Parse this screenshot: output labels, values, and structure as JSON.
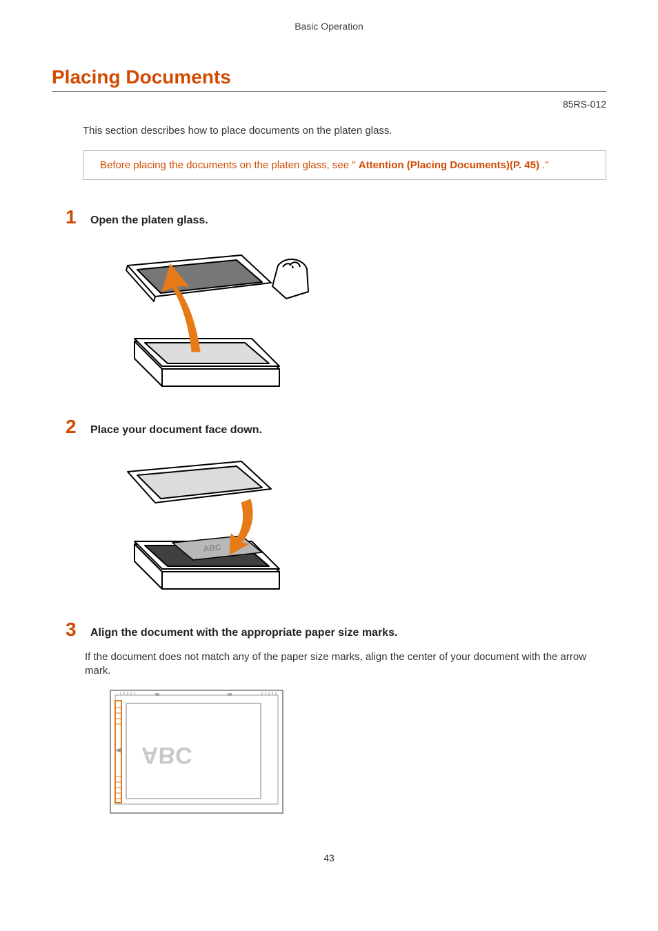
{
  "header": {
    "section_label": "Basic Operation"
  },
  "title": "Placing Documents",
  "doc_code": "85RS-012",
  "intro": "This section describes how to place documents on the platen glass.",
  "note": {
    "prefix": "Before placing the documents on the platen glass, see \" ",
    "link": "Attention (Placing Documents)(P. 45)",
    "suffix": " .\""
  },
  "steps": [
    {
      "num": "1",
      "title": "Open the platen glass.",
      "body": ""
    },
    {
      "num": "2",
      "title": "Place your document face down.",
      "body": ""
    },
    {
      "num": "3",
      "title": "Align the document with the appropriate paper size marks.",
      "body": "If the document does not match any of the paper size marks, align the center of your document with the arrow mark."
    }
  ],
  "page_number": "43"
}
